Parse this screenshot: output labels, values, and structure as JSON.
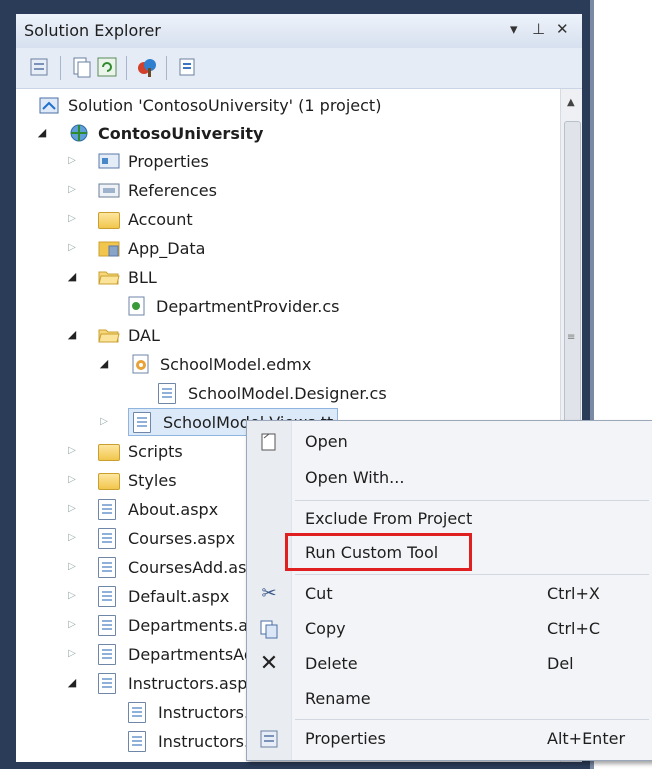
{
  "window": {
    "title": "Solution Explorer",
    "pin_glyph": "▾ ⊥ ✕"
  },
  "toolbar": {
    "icons": [
      "properties-icon",
      "show-all-files-icon",
      "refresh-icon",
      "view-class-diagram-icon",
      "view-code-icon"
    ]
  },
  "tree": {
    "solution": "Solution 'ContosoUniversity' (1 project)",
    "project": "ContosoUniversity",
    "items": [
      {
        "label": "Properties"
      },
      {
        "label": "References"
      },
      {
        "label": "Account"
      },
      {
        "label": "App_Data"
      },
      {
        "label": "BLL"
      },
      {
        "label": "DepartmentProvider.cs"
      },
      {
        "label": "DAL"
      },
      {
        "label": "SchoolModel.edmx"
      },
      {
        "label": "SchoolModel.Designer.cs"
      },
      {
        "label": "SchoolModel.Views.tt"
      },
      {
        "label": "Scripts"
      },
      {
        "label": "Styles"
      },
      {
        "label": "About.aspx"
      },
      {
        "label": "Courses.aspx"
      },
      {
        "label": "CoursesAdd.aspx"
      },
      {
        "label": "Default.aspx"
      },
      {
        "label": "Departments.aspx"
      },
      {
        "label": "DepartmentsAdd.aspx"
      },
      {
        "label": "Instructors.aspx"
      },
      {
        "label": "Instructors.aspx.cs"
      },
      {
        "label": "Instructors.aspx.designer.cs"
      }
    ]
  },
  "context_menu": {
    "items": [
      {
        "label": "Open",
        "shortcut": ""
      },
      {
        "label": "Open With...",
        "shortcut": ""
      },
      {
        "label": "Exclude From Project",
        "shortcut": ""
      },
      {
        "label": "Run Custom Tool",
        "shortcut": ""
      },
      {
        "label": "Cut",
        "shortcut": "Ctrl+X"
      },
      {
        "label": "Copy",
        "shortcut": "Ctrl+C"
      },
      {
        "label": "Delete",
        "shortcut": "Del"
      },
      {
        "label": "Rename",
        "shortcut": ""
      },
      {
        "label": "Properties",
        "shortcut": "Alt+Enter"
      }
    ]
  },
  "colors": {
    "frame": "#2b3c59",
    "highlight": "#e02020",
    "selection": "#dce9f8"
  }
}
